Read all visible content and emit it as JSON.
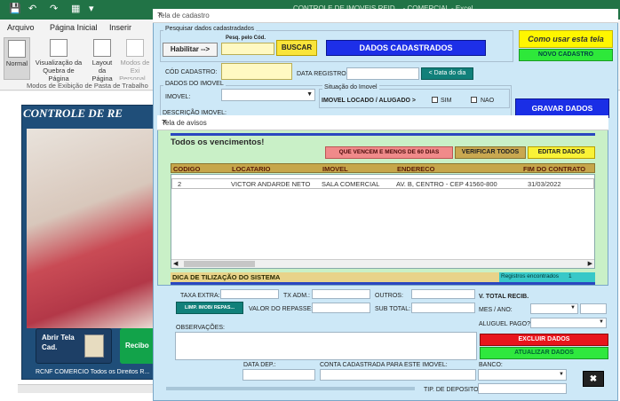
{
  "excel": {
    "title": "CONTROLE DE IMOVEIS REID... - COMERCIAL - Excel",
    "tabs": [
      "Arquivo",
      "Página Inicial",
      "Inserir"
    ],
    "ribbon": {
      "normal": "Normal",
      "visualizacao": "Visualização da Quebra de Página",
      "layout": "Layout da Página",
      "modos": "Modos de Exi Personal...",
      "group_label": "Modos de Exibição de Pasta de Trabalho"
    },
    "sheet": {
      "header": "CONTROLE DE RE",
      "abrir_btn": "Abrir Tela Cad.",
      "recibo_btn": "Recibo",
      "footer": "RCNF COMERCIO Todos os Direitos R..."
    }
  },
  "form": {
    "title": "Tela de cadastro",
    "search_frame": "Pesquisar dados cadastradados",
    "habilitar": "Habilitar -->",
    "pesq_label": "Pesq. pelo Cód.",
    "buscar": "BUSCAR",
    "dados_cadastrados": "DADOS CADASTRADOS",
    "como_usar": "Como usar esta tela",
    "novo_cadastro": "NOVO CADASTRO",
    "cod_cadastro": "CÓD CADASTRO:",
    "data_registro": "DATA REGISTRO:",
    "data_do_dia": "< Data do dia",
    "dados_imovel": "DADOS DO IMOVEL",
    "imovel": "IMOVEL:",
    "situacao": "Situação do Imovel",
    "imovel_locado": "IMOVEL LOCADO / ALUGADO >",
    "sim": "SIM",
    "nao": "NAO",
    "descricao": "DESCRIÇÃO IMOVEL:",
    "gravar": "GRAVAR DADOS",
    "taxa_extra": "TAXA EXTRA:",
    "tx_adm": "TX ADM.:",
    "outros": "OUTROS:",
    "v_total": "V. TOTAL RECIB.",
    "limp_btn": "LIMP. IMOB/ REPAS...",
    "valor_repasse": "VALOR DO REPASSE:",
    "sub_total": "SUB TOTAL:",
    "mes_ano": "MES / ANO:",
    "aluguel_pago": "ALUGUEL PAGO?",
    "observacoes": "OBSERVAÇÕES:",
    "excluir": "EXCLUIR DADOS",
    "atualizar": "ATUALIZAR DADOS",
    "data_dep": "DATA DEP.:",
    "conta_cadastrada": "CONTA CADASTRADA PARA ESTE IMOVEL:",
    "banco": "BANCO:",
    "tip_deposito": "TIP. DE DEPOSITO"
  },
  "aviso": {
    "title": "Tela de avisos",
    "heading": "Todos os vencimentos!",
    "btn_60": "QUE VENCEM E MENOS DE 60 DIAS",
    "btn_verificar": "VERIFICAR TODOS",
    "btn_editar": "EDITAR DADOS",
    "columns": [
      "CODIGO",
      "LOCATARIO",
      "IMOVEL",
      "ENDERECO",
      "FIM DO CONTRATO"
    ],
    "rows": [
      [
        "2",
        "VICTOR ANDARDE NETO",
        "SALA COMERCIAL",
        "AV. B, CENTRO - CEP 41560-800",
        "31/03/2022"
      ]
    ],
    "dica": "DICA DE TILIZAÇÃO DO SISTEMA",
    "registros_label": "Registros encontrados",
    "registros_count": "1"
  }
}
